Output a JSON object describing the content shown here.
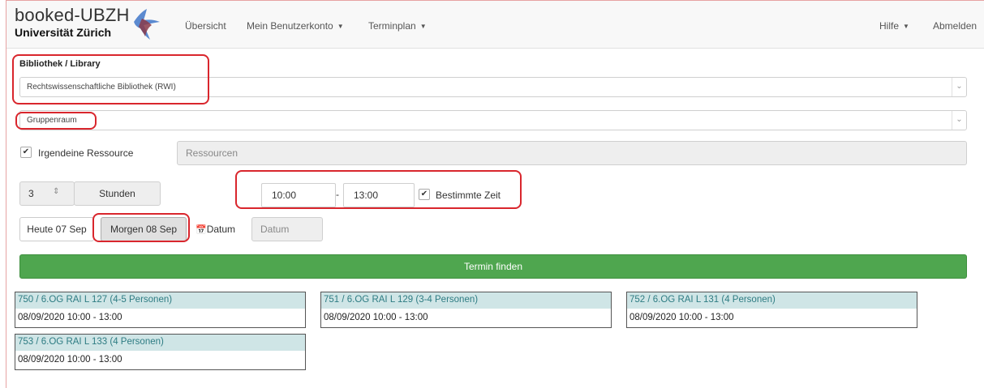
{
  "brand": {
    "line1": "booked-UBZH",
    "line2": "Universität Zürich"
  },
  "nav": {
    "overview": "Übersicht",
    "account": "Mein Benutzerkonto",
    "schedule": "Terminplan",
    "help": "Hilfe",
    "logout": "Abmelden"
  },
  "form": {
    "library_label": "Bibliothek / Library",
    "library_value": "Rechtswissenschaftliche Bibliothek (RWI)",
    "room_type_value": "Gruppenraum",
    "any_resource_label": "Irgendeine Ressource",
    "resources_placeholder": "Ressourcen",
    "duration_value": "3",
    "duration_unit": "Stunden",
    "time_from": "10:00",
    "time_sep": "-",
    "time_to": "13:00",
    "specific_time_label": "Bestimmte Zeit",
    "today_label": "Heute 07 Sep",
    "tomorrow_label": "Morgen 08 Sep",
    "date_button_label": "Datum",
    "date_input_placeholder": "Datum",
    "find_button_label": "Termin finden"
  },
  "results": [
    {
      "title": "750 / 6.OG RAI L 127 (4-5 Personen)",
      "time": "08/09/2020 10:00 - 13:00"
    },
    {
      "title": "751 / 6.OG RAI L 129 (3-4 Personen)",
      "time": "08/09/2020 10:00 - 13:00"
    },
    {
      "title": "752 / 6.OG RAI L 131 (4 Personen)",
      "time": "08/09/2020 10:00 - 13:00"
    },
    {
      "title": "753 / 6.OG RAI L 133 (4 Personen)",
      "time": "08/09/2020 10:00 - 13:00"
    }
  ],
  "colors": {
    "highlight_outline": "#d9262d",
    "find_button": "#4fa64f",
    "result_header": "#cfe5e6",
    "result_title_text": "#2e7c83"
  }
}
